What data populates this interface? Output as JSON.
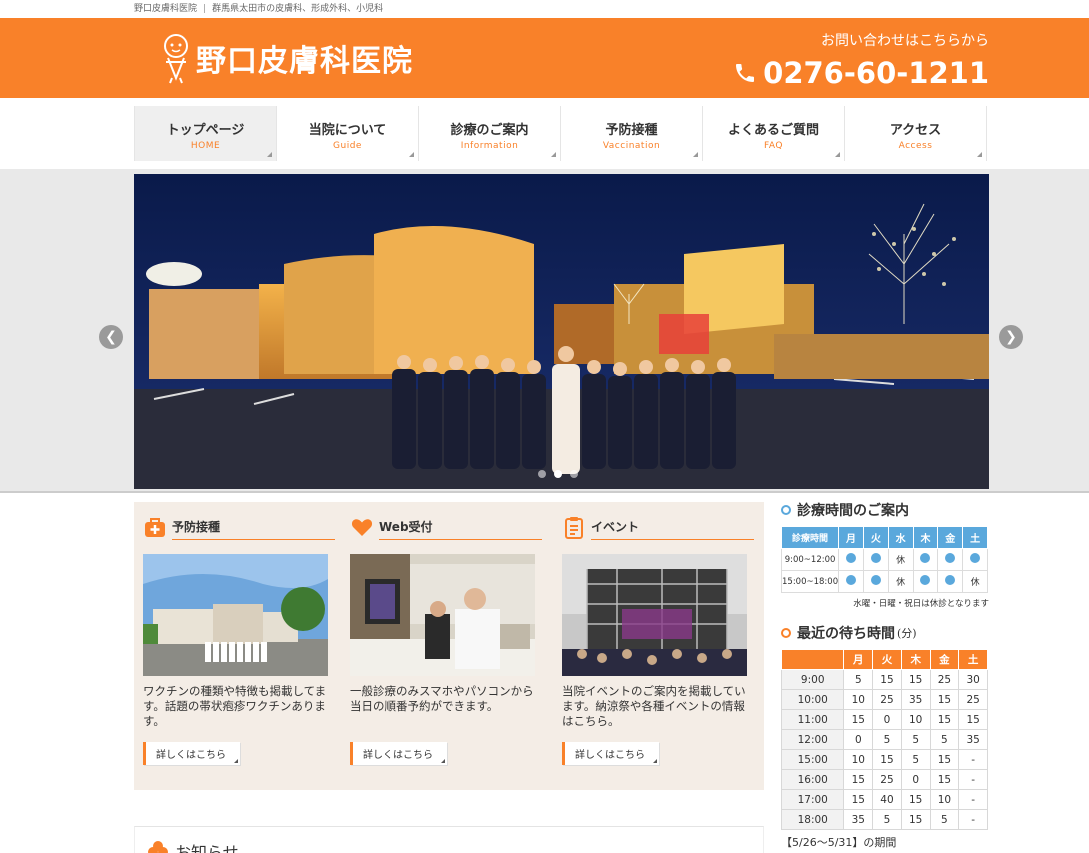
{
  "topbar": {
    "clinic_name": "野口皮膚科医院",
    "description": "群馬県太田市の皮膚科、形成外科、小児科"
  },
  "header": {
    "logo_text": "野口皮膚科医院",
    "contact_label": "お問い合わせはこちらから",
    "phone": "0276-60-1211",
    "brand_color": "#f98129"
  },
  "nav": {
    "items": [
      {
        "jp": "トップページ",
        "en": "HOME"
      },
      {
        "jp": "当院について",
        "en": "Guide"
      },
      {
        "jp": "診療のご案内",
        "en": "Information"
      },
      {
        "jp": "予防接種",
        "en": "Vaccination"
      },
      {
        "jp": "よくあるご質問",
        "en": "FAQ"
      },
      {
        "jp": "アクセス",
        "en": "Access"
      }
    ]
  },
  "slider": {
    "prev_icon": "chevron-left-icon",
    "next_icon": "chevron-right-icon",
    "slide_count": 3,
    "active_index": 1
  },
  "cards": [
    {
      "title": "予防接種",
      "icon": "first-aid-bag-icon",
      "text": "ワクチンの種類や特徴も掲載してます。話題の帯状疱疹ワクチンあります。",
      "button": "詳しくはこちら"
    },
    {
      "title": "Web受付",
      "icon": "heart-icon",
      "text": "一般診療のみスマホやパソコンから当日の順番予約ができます。",
      "button": "詳しくはこちら"
    },
    {
      "title": "イベント",
      "icon": "clipboard-icon",
      "text": "当院イベントのご案内を掲載しています。納涼祭や各種イベントの情報はこちら。",
      "button": "詳しくはこちら"
    }
  ],
  "news": {
    "title": "お知らせ"
  },
  "hours": {
    "title": "診療時間のご案内",
    "header": [
      "診療時間",
      "月",
      "火",
      "水",
      "木",
      "金",
      "土"
    ],
    "rows": [
      {
        "time": "9:00~12:00",
        "cells": [
          "●",
          "●",
          "休",
          "●",
          "●",
          "●"
        ]
      },
      {
        "time": "15:00~18:00",
        "cells": [
          "●",
          "●",
          "休",
          "●",
          "●",
          "休"
        ]
      }
    ],
    "note": "水曜・日曜・祝日は休診となります"
  },
  "wait": {
    "title": "最近の待ち時間",
    "unit": "(分)",
    "header": [
      "",
      "月",
      "火",
      "木",
      "金",
      "土"
    ],
    "rows": [
      [
        "9:00",
        "5",
        "15",
        "15",
        "25",
        "30"
      ],
      [
        "10:00",
        "10",
        "25",
        "35",
        "15",
        "25"
      ],
      [
        "11:00",
        "15",
        "0",
        "10",
        "15",
        "15"
      ],
      [
        "12:00",
        "0",
        "5",
        "5",
        "5",
        "35"
      ],
      [
        "15:00",
        "10",
        "15",
        "5",
        "15",
        "-"
      ],
      [
        "16:00",
        "15",
        "25",
        "0",
        "15",
        "-"
      ],
      [
        "17:00",
        "15",
        "40",
        "15",
        "10",
        "-"
      ],
      [
        "18:00",
        "35",
        "5",
        "15",
        "5",
        "-"
      ]
    ],
    "period": "【5/26～5/31】の期間"
  }
}
